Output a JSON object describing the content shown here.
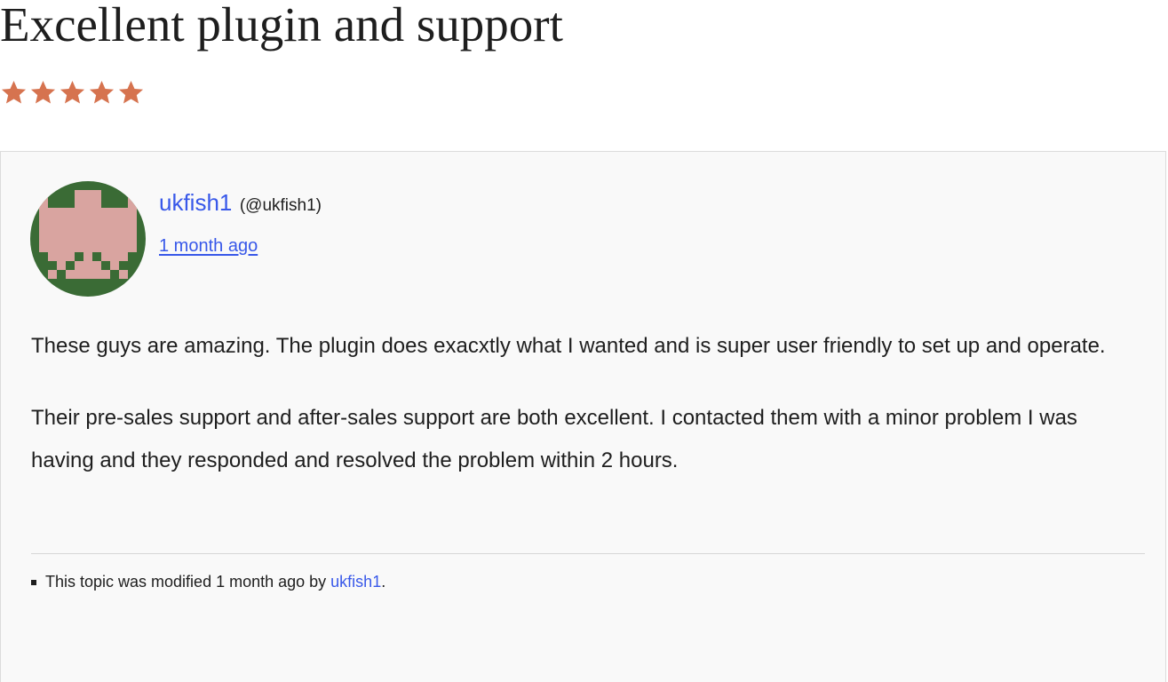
{
  "review": {
    "title": "Excellent plugin and support",
    "rating": 5,
    "rating_max": 5,
    "star_color": "#d6734f"
  },
  "author": {
    "name": "ukfish1",
    "handle": "(@ukfish1)",
    "date": "1 month ago",
    "avatar_colors": {
      "background": "#3a6b35",
      "figure": "#d9a4a0"
    }
  },
  "body": {
    "paragraph_1": "These guys are amazing. The plugin does exacxtly what I wanted and is super user friendly to set up and operate.",
    "paragraph_2": "Their pre-sales support and after-sales support are both excellent. I contacted them with a minor problem I was having and they responded and resolved the problem within 2 hours."
  },
  "modification": {
    "prefix": "This topic was modified 1 month ago by ",
    "user": "ukfish1",
    "suffix": "."
  },
  "theme": {
    "link_color": "#3858e9",
    "text_color": "#1e1e1e",
    "card_background": "#f9f9f9"
  }
}
